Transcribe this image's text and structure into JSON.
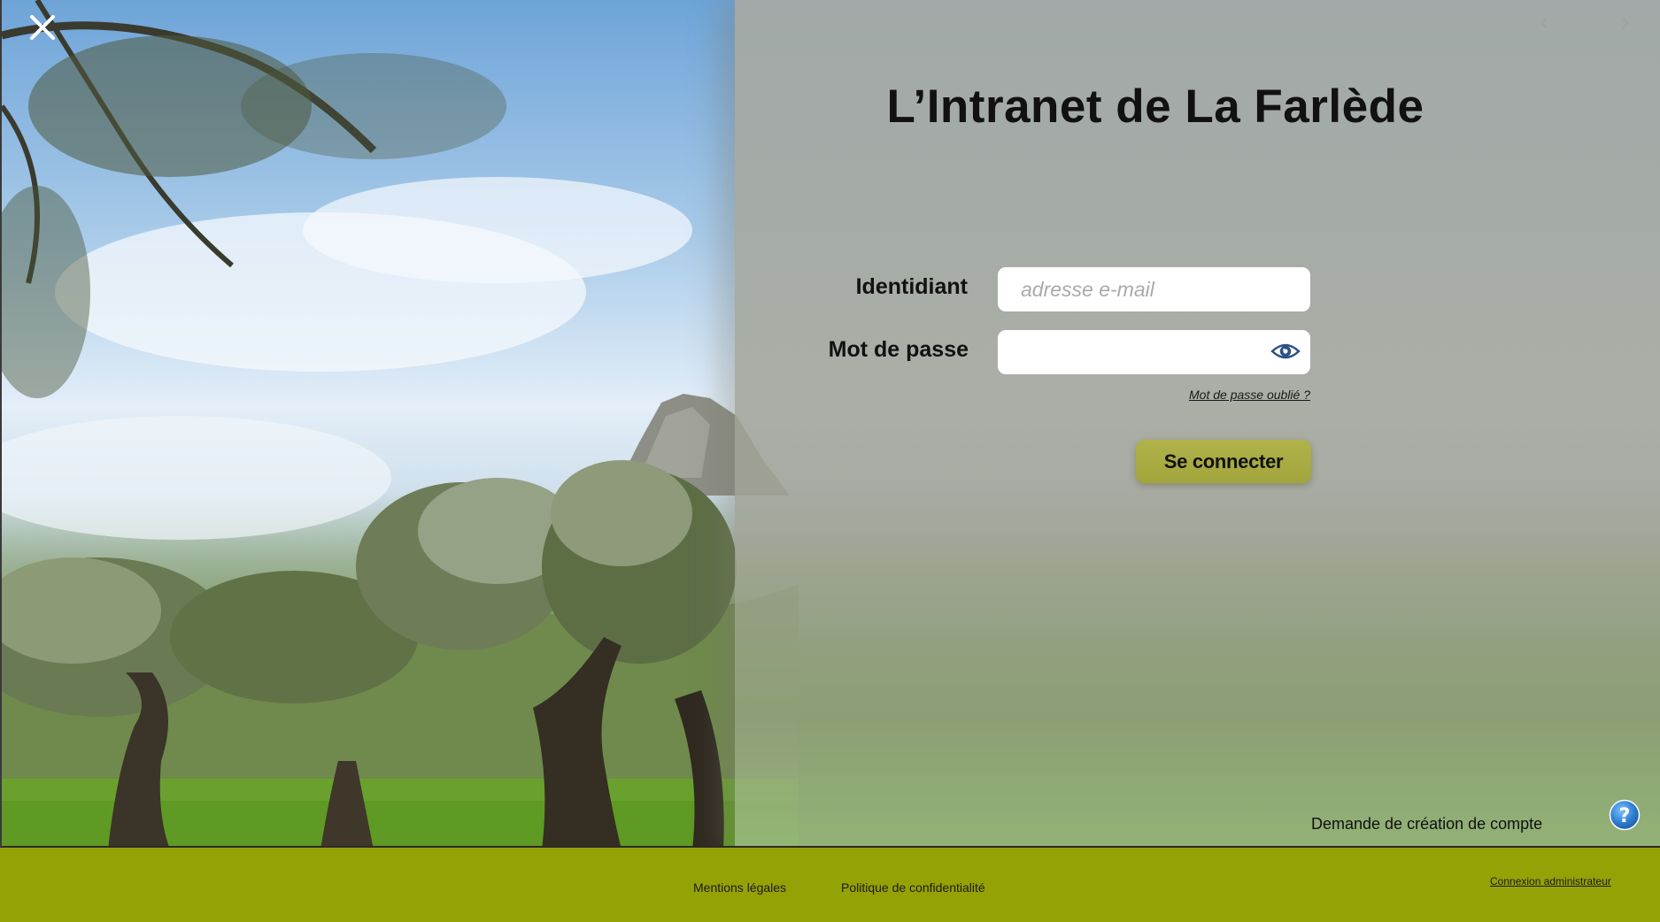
{
  "page": {
    "title": "L’Intranet de La Farlède"
  },
  "form": {
    "identifier_label": "Identidiant",
    "identifier_placeholder": "adresse e-mail",
    "identifier_value": "",
    "password_label": "Mot de passe",
    "password_value": "",
    "forgot_password": "Mot de passe oublié ?",
    "submit_label": "Se connecter"
  },
  "links": {
    "create_account": "Demande de création de compte"
  },
  "footer": {
    "legal": "Mentions légales",
    "privacy": "Politique de confidentialité",
    "admin_login": "Connexion administrateur"
  },
  "icons": {
    "close": "close-icon",
    "reveal_password": "eye-icon",
    "help": "help-icon"
  },
  "colors": {
    "footer_bg": "#95a205",
    "button_bg": "#a8aa42",
    "eye_icon": "#2a4f8a",
    "help_icon": "#2f7fd2"
  }
}
